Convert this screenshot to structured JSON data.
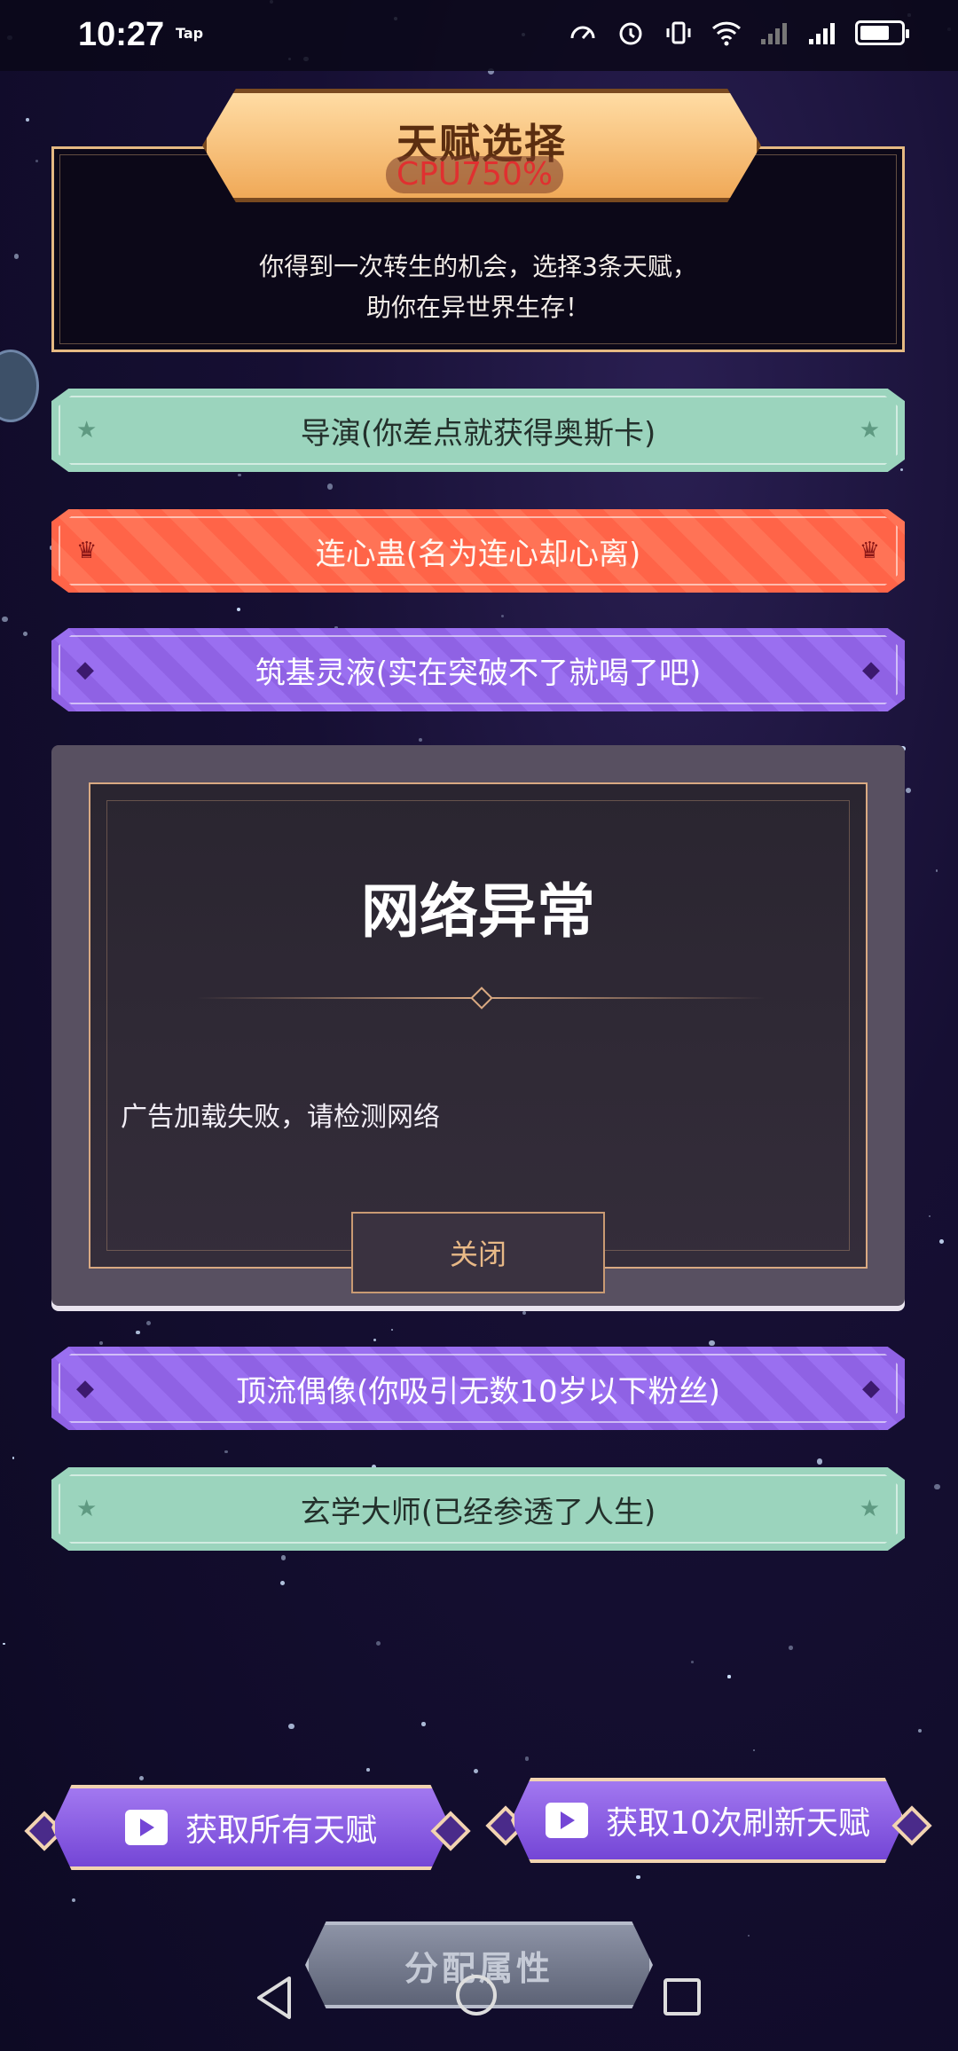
{
  "status_bar": {
    "time": "10:27",
    "tap_label": "Tap"
  },
  "header": {
    "title": "天赋选择",
    "cpu_overlay": "CPU750%",
    "description_line1": "你得到一次转生的机会，选择3条天赋，",
    "description_line2": "助你在异世界生存！"
  },
  "talents": [
    {
      "label": "导演(你差点就获得奥斯卡)",
      "style": "green",
      "icon": "star-icon"
    },
    {
      "label": "连心蛊(名为连心却心离)",
      "style": "red",
      "icon": "crown-icon"
    },
    {
      "label": "筑基灵液(实在突破不了就喝了吧)",
      "style": "purple",
      "icon": "gem-icon"
    },
    {
      "label": "顶流偶像(你吸引无数10岁以下粉丝)",
      "style": "purple",
      "icon": "gem-icon"
    },
    {
      "label": "玄学大师(已经参透了人生)",
      "style": "green",
      "icon": "star-icon"
    }
  ],
  "dialog": {
    "title": "网络异常",
    "message": "广告加载失败，请检测网络",
    "close_label": "关闭"
  },
  "buttons": {
    "get_all_talents": "获取所有天赋",
    "refresh_talents": "获取10次刷新天赋",
    "assign_attributes": "分配属性"
  },
  "colors": {
    "green_card": "#9bd4bd",
    "red_card": "#ff6448",
    "purple_card": "#8f62e4",
    "gold_accent": "#e5b982"
  }
}
